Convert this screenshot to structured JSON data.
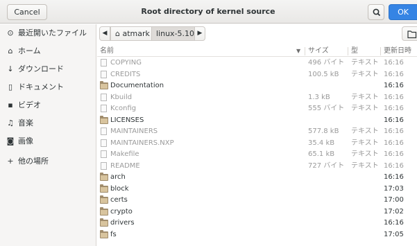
{
  "header": {
    "cancel_label": "Cancel",
    "title": "Root directory of kernel source",
    "ok_label": "OK"
  },
  "sidebar": {
    "items": [
      {
        "icon": "clock-icon",
        "glyph": "⊙",
        "label": "最近開いたファイル"
      },
      {
        "icon": "home-icon",
        "glyph": "⌂",
        "label": "ホーム"
      },
      {
        "icon": "download-icon",
        "glyph": "↓",
        "label": "ダウンロード"
      },
      {
        "icon": "document-icon",
        "glyph": "▯",
        "label": "ドキュメント"
      },
      {
        "icon": "video-icon",
        "glyph": "▪",
        "label": "ビデオ"
      },
      {
        "icon": "music-icon",
        "glyph": "♫",
        "label": "音楽"
      },
      {
        "icon": "camera-icon",
        "glyph": "◙",
        "label": "画像"
      },
      {
        "icon": "plus-icon",
        "glyph": "+",
        "label": "他の場所"
      }
    ]
  },
  "pathbar": {
    "back": "◀",
    "forward": "▶",
    "crumbs": [
      {
        "label": "⌂ atmark"
      },
      {
        "label": "linux-5.10"
      }
    ]
  },
  "columns": {
    "name": "名前",
    "size": "サイズ",
    "type": "型",
    "modified": "更新日時"
  },
  "files": [
    {
      "kind": "file",
      "name": "COPYING",
      "size": "496 バイト",
      "type": "テキスト",
      "time": "16:16"
    },
    {
      "kind": "file",
      "name": "CREDITS",
      "size": "100.5 kB",
      "type": "テキスト",
      "time": "16:16"
    },
    {
      "kind": "dir",
      "name": "Documentation",
      "size": "",
      "type": "",
      "time": "16:16"
    },
    {
      "kind": "file",
      "name": "Kbuild",
      "size": "1.3 kB",
      "type": "テキスト",
      "time": "16:16"
    },
    {
      "kind": "file",
      "name": "Kconfig",
      "size": "555 バイト",
      "type": "テキスト",
      "time": "16:16"
    },
    {
      "kind": "dir",
      "name": "LICENSES",
      "size": "",
      "type": "",
      "time": "16:16"
    },
    {
      "kind": "file",
      "name": "MAINTAINERS",
      "size": "577.8 kB",
      "type": "テキスト",
      "time": "16:16"
    },
    {
      "kind": "file",
      "name": "MAINTAINERS.NXP",
      "size": "35.4 kB",
      "type": "テキスト",
      "time": "16:16"
    },
    {
      "kind": "file",
      "name": "Makefile",
      "size": "65.1 kB",
      "type": "テキスト",
      "time": "16:16"
    },
    {
      "kind": "file",
      "name": "README",
      "size": "727 バイト",
      "type": "テキスト",
      "time": "16:16"
    },
    {
      "kind": "dir",
      "name": "arch",
      "size": "",
      "type": "",
      "time": "16:16"
    },
    {
      "kind": "dir",
      "name": "block",
      "size": "",
      "type": "",
      "time": "17:03"
    },
    {
      "kind": "dir",
      "name": "certs",
      "size": "",
      "type": "",
      "time": "17:00"
    },
    {
      "kind": "dir",
      "name": "crypto",
      "size": "",
      "type": "",
      "time": "17:02"
    },
    {
      "kind": "dir",
      "name": "drivers",
      "size": "",
      "type": "",
      "time": "16:16"
    },
    {
      "kind": "dir",
      "name": "fs",
      "size": "",
      "type": "",
      "time": "17:05"
    }
  ]
}
